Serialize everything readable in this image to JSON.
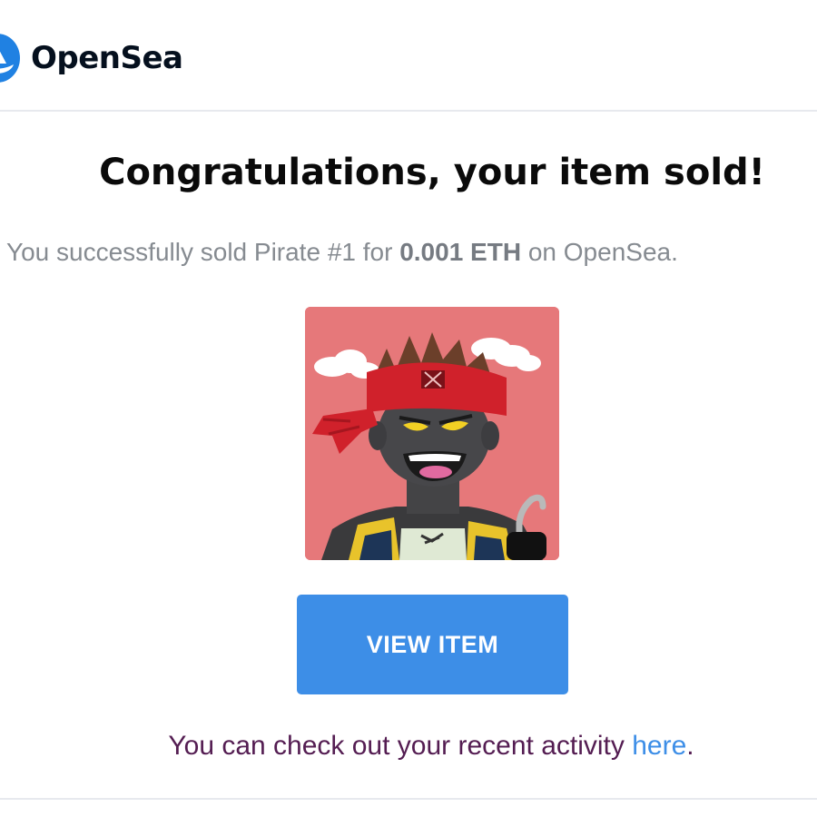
{
  "header": {
    "brand_name": "OpenSea",
    "logo_icon": "opensea-logo-icon",
    "brand_color": "#2081e2"
  },
  "email": {
    "headline": "Congratulations, your item sold!",
    "summary": {
      "prefix": "You successfully sold Pirate #1 for ",
      "price": "0.001 ETH",
      "suffix": " on OpenSea."
    },
    "item_image": {
      "icon": "pirate-nft-image",
      "background_color": "#e6787a"
    },
    "view_button_label": "VIEW ITEM",
    "button_color": "#3d8ee7",
    "activity": {
      "text": "You can check out your recent activity ",
      "link_text": "here",
      "end": "."
    }
  }
}
